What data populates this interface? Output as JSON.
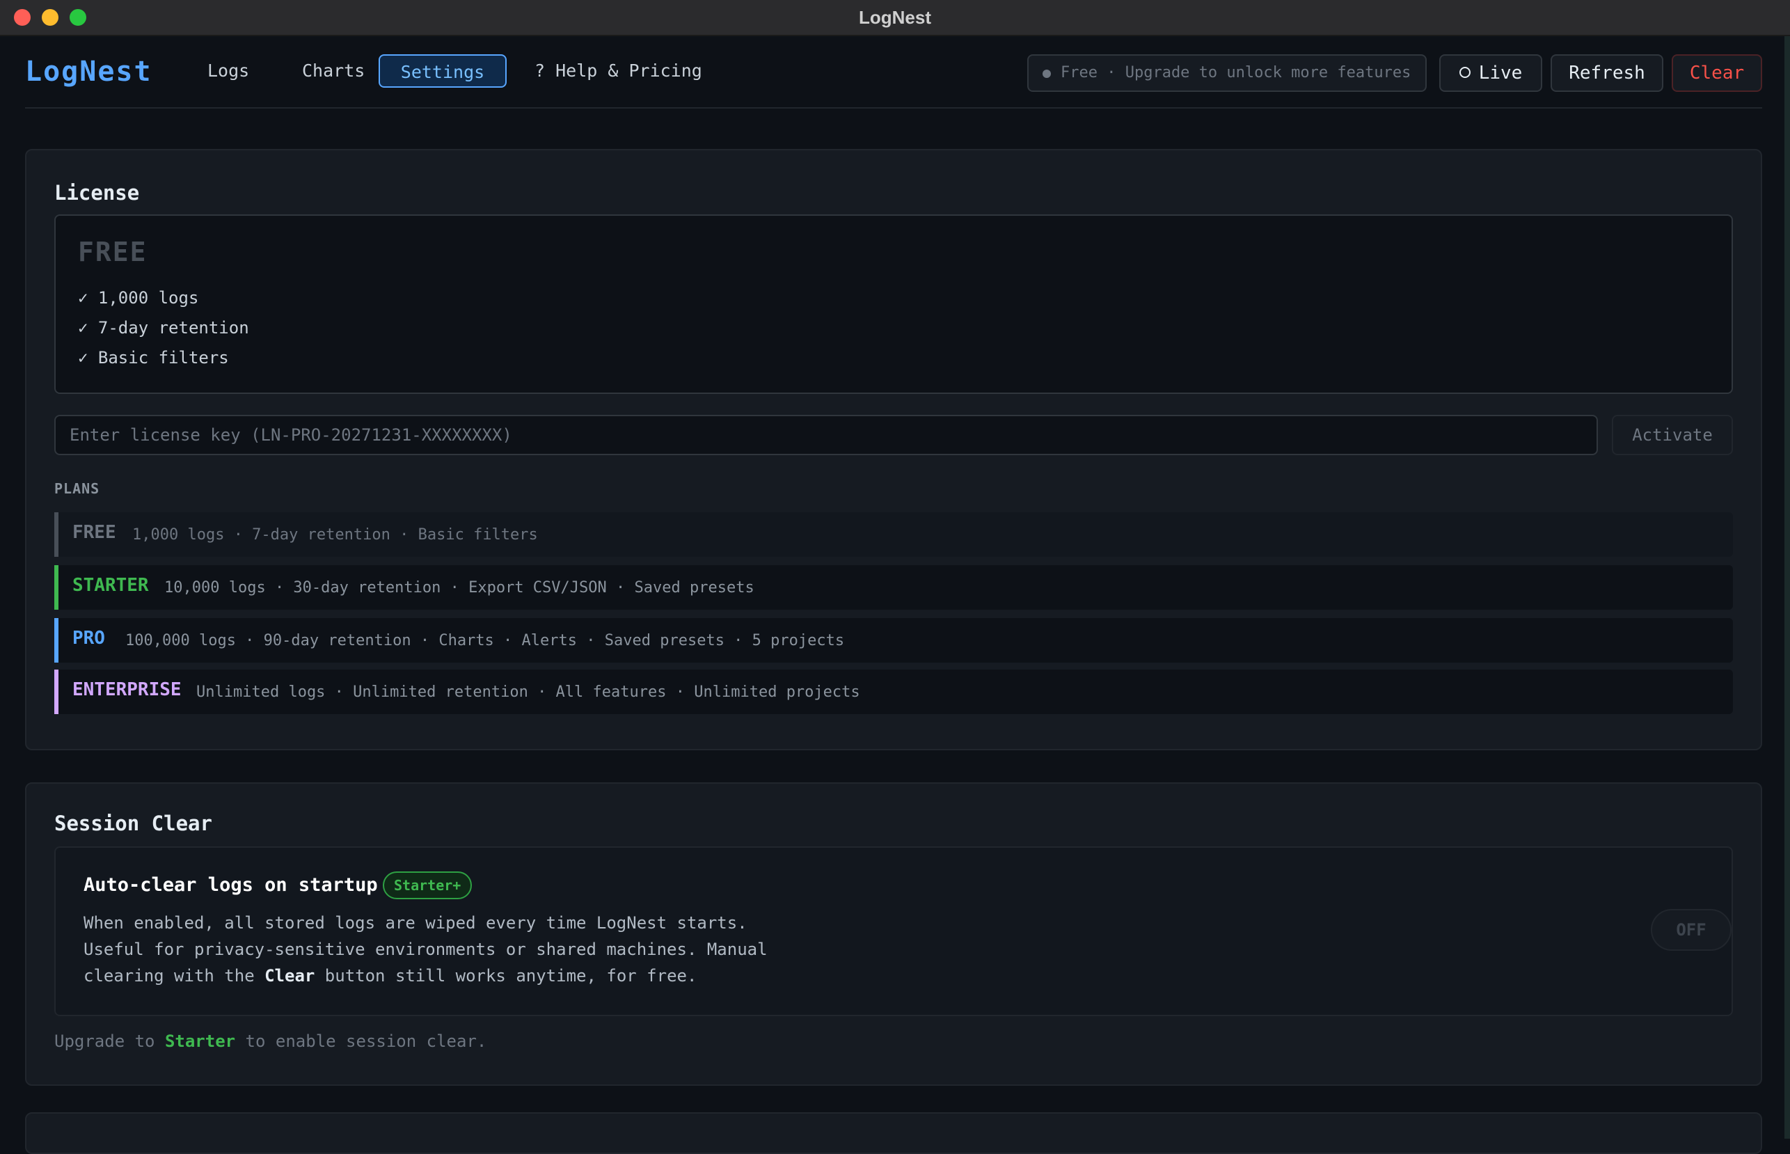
{
  "window": {
    "title": "LogNest"
  },
  "header": {
    "brand": "LogNest",
    "tabs": [
      {
        "label": "Logs",
        "active": false
      },
      {
        "label": "Charts",
        "active": false
      },
      {
        "label": "Settings",
        "active": true
      },
      {
        "label": "? Help & Pricing",
        "active": false
      }
    ],
    "plan_status": "Free · Upgrade to unlock more features",
    "live_label": "Live",
    "refresh_label": "Refresh",
    "clear_label": "Clear"
  },
  "license": {
    "title": "License",
    "current_tier": "FREE",
    "features": [
      "✓ 1,000 logs",
      "✓ 7-day retention",
      "✓ Basic filters"
    ],
    "key_input": {
      "value": "",
      "placeholder": "Enter license key (LN-PRO-20271231-XXXXXXXX)"
    },
    "activate_label": "Activate",
    "plans_label": "PLANS",
    "plans": [
      {
        "name": "FREE",
        "desc": "1,000 logs · 7-day retention · Basic filters",
        "color": "#6e7681"
      },
      {
        "name": "STARTER",
        "desc": "10,000 logs · 30-day retention · Export CSV/JSON · Saved presets",
        "color": "#3fb950"
      },
      {
        "name": "PRO",
        "desc": "100,000 logs · 90-day retention · Charts · Alerts · Saved presets · 5 projects",
        "color": "#58a6ff"
      },
      {
        "name": "ENTERPRISE",
        "desc": "Unlimited logs · Unlimited retention · All features · Unlimited projects",
        "color": "#d2a8ff"
      }
    ]
  },
  "session": {
    "title": "Session Clear",
    "feature_title": "Auto-clear logs on startup",
    "badge": "Starter+",
    "desc_line1": "When enabled, all stored logs are wiped every time LogNest starts.",
    "desc_line2": "Useful for privacy-sensitive environments or shared machines. Manual",
    "desc_line3_pre": "clearing with the ",
    "desc_line3_bold": "Clear",
    "desc_line3_post": " button still works anytime, for free.",
    "toggle_label": "OFF",
    "upgrade_pre": "Upgrade to ",
    "upgrade_plan": "Starter",
    "upgrade_post": " to enable session clear."
  }
}
